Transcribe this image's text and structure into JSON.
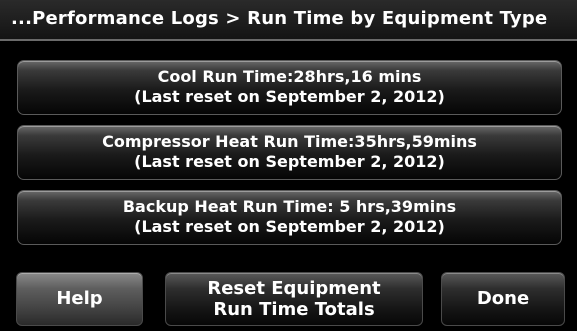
{
  "header": {
    "title": "...Performance Logs > Run Time by Equipment Type"
  },
  "logs": [
    {
      "label": "Cool Run Time:28hrs,16 mins",
      "reset_note": "(Last reset on September 2, 2012)"
    },
    {
      "label": "Compressor Heat Run Time:35hrs,59mins",
      "reset_note": "(Last reset on September 2, 2012)"
    },
    {
      "label": "Backup Heat Run Time: 5 hrs,39mins",
      "reset_note": "(Last reset on September 2, 2012)"
    }
  ],
  "footer": {
    "help_label": "Help",
    "reset_line1": "Reset Equipment",
    "reset_line2": "Run Time Totals",
    "done_label": "Done"
  }
}
